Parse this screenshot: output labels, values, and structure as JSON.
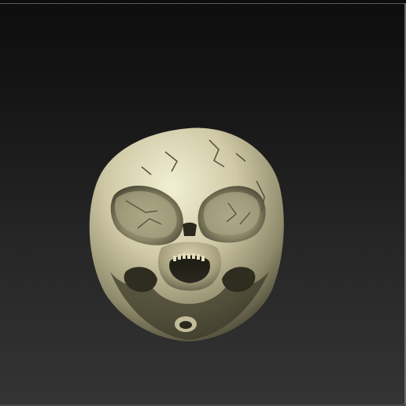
{
  "viewport": {
    "background_top": "#0d0d0d",
    "background_bottom": "#343434",
    "border_color": "#5a5a5a"
  },
  "model": {
    "subject": "alien-skull-sculpt",
    "material_light": "#e4e1c3",
    "material_mid": "#b4ae8c",
    "material_shadow": "#3a3828"
  }
}
